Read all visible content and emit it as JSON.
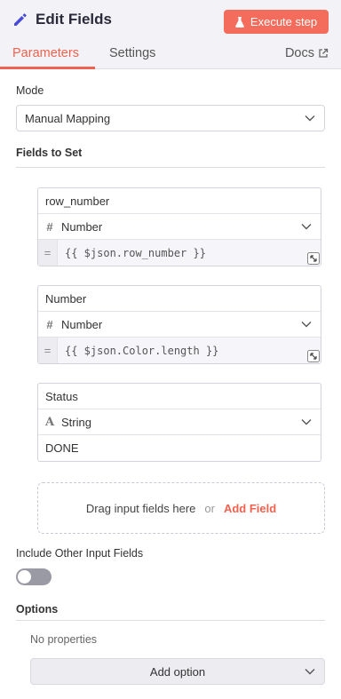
{
  "header": {
    "title": "Edit Fields",
    "execute_label": "Execute step",
    "tabs": [
      {
        "label": "Parameters",
        "active": true
      },
      {
        "label": "Settings",
        "active": false
      }
    ],
    "docs_label": "Docs",
    "accent_color": "#f0624f"
  },
  "mode": {
    "label": "Mode",
    "value": "Manual Mapping"
  },
  "fields_section": {
    "label": "Fields to Set",
    "fields": [
      {
        "name": "row_number",
        "type_icon": "#",
        "type": "Number",
        "value": "{{ $json.row_number }}",
        "is_expression": true
      },
      {
        "name": "Number",
        "type_icon": "#",
        "type": "Number",
        "value": "{{ $json.Color.length }}",
        "is_expression": true
      },
      {
        "name": "Status",
        "type_icon": "A",
        "type": "String",
        "value": "DONE",
        "is_expression": false
      }
    ],
    "dropzone": {
      "text": "Drag input fields here",
      "or": "or",
      "add_label": "Add Field"
    }
  },
  "include_other": {
    "label": "Include Other Input Fields",
    "enabled": false
  },
  "options": {
    "label": "Options",
    "empty_text": "No properties",
    "add_label": "Add option"
  }
}
